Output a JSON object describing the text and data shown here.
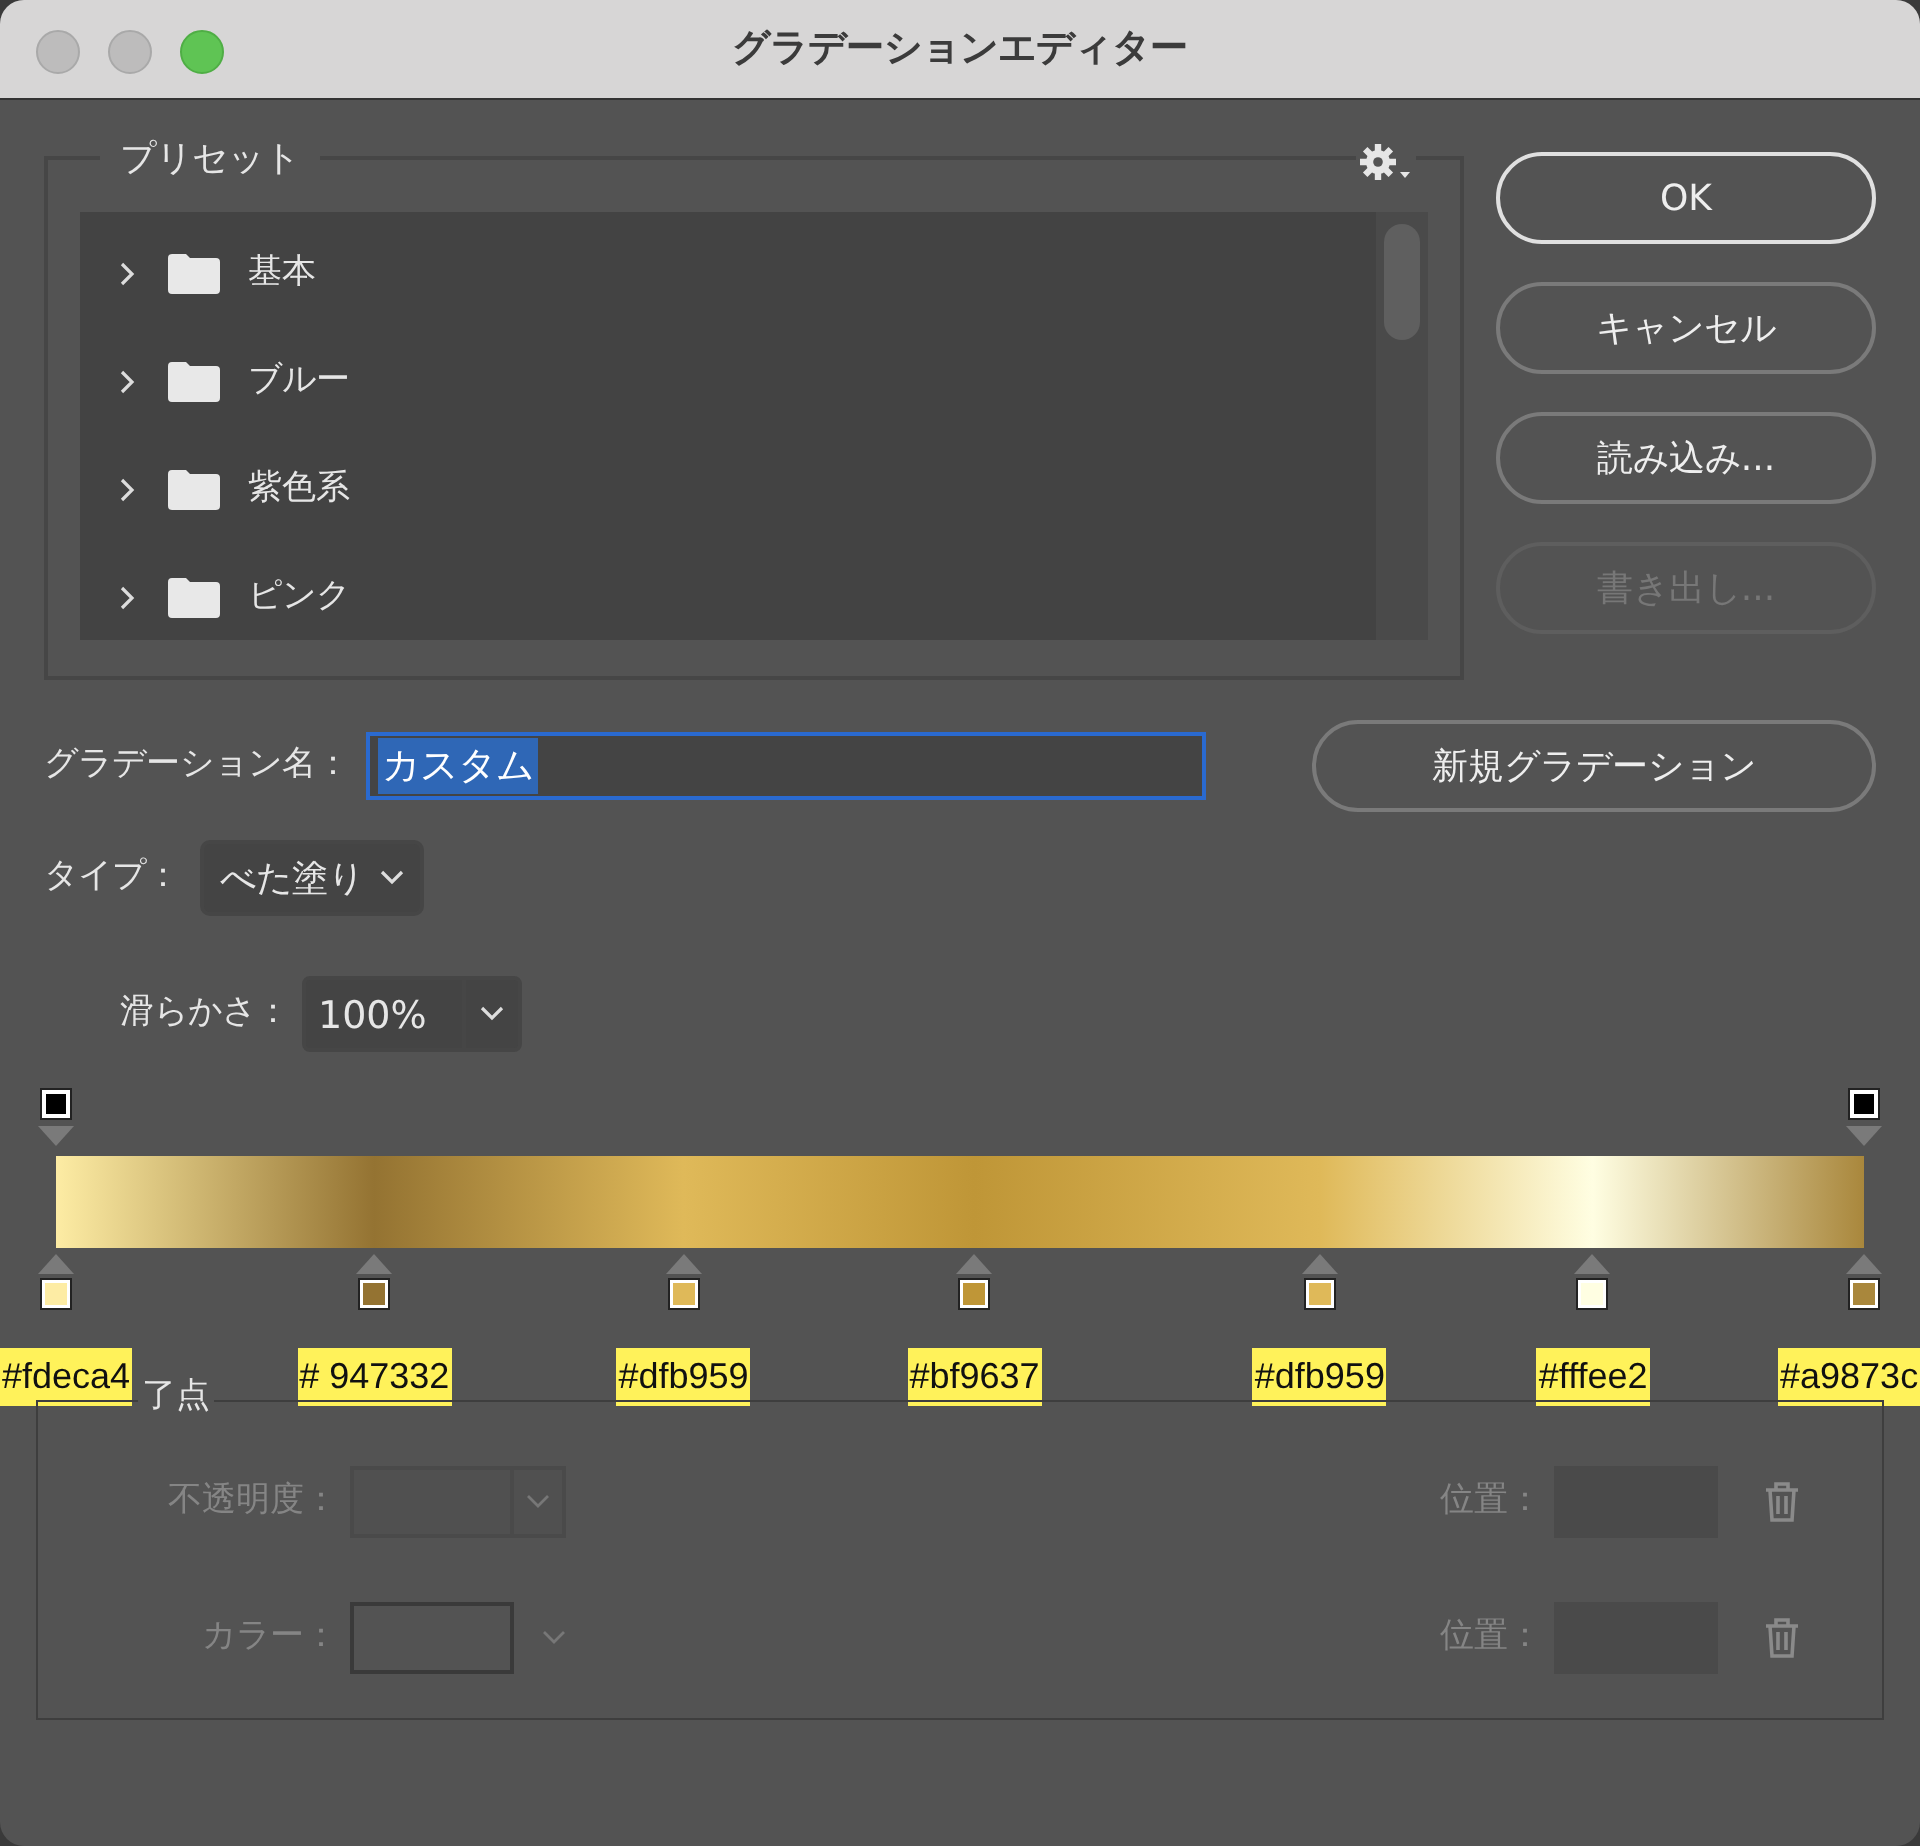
{
  "window": {
    "title": "グラデーションエディター"
  },
  "presets": {
    "legend": "プリセット",
    "items": [
      {
        "label": "基本",
        "expanded": false
      },
      {
        "label": "ブルー",
        "expanded": false
      },
      {
        "label": "紫色系",
        "expanded": false
      },
      {
        "label": "ピンク",
        "expanded": false
      }
    ]
  },
  "buttons": [
    {
      "label": "OK",
      "kind": "default",
      "disabled": false
    },
    {
      "label": "キャンセル",
      "kind": "normal",
      "disabled": false
    },
    {
      "label": "読み込み...",
      "kind": "normal",
      "disabled": false
    },
    {
      "label": "書き出し...",
      "kind": "normal",
      "disabled": true
    }
  ],
  "name_field": {
    "label": "グラデーション名：",
    "value": "カスタム"
  },
  "new_button": {
    "label": "新規グラデーション"
  },
  "type": {
    "label": "タイプ：",
    "value": "べた塗り"
  },
  "smoothness": {
    "label": "滑らかさ：",
    "value": "100%"
  },
  "opacity_stops": [
    {
      "color": "#000000",
      "level": 0
    },
    {
      "color": "#000000",
      "level": 1
    }
  ],
  "color_stops": [
    {
      "color": "#fdeca4",
      "level": 0,
      "label": "#fdeca4"
    },
    {
      "color": "#947332",
      "level": 0.176,
      "label": "# 947332"
    },
    {
      "color": "#dfb959",
      "level": 0.347,
      "label": "#dfb959"
    },
    {
      "color": "#bf9637",
      "level": 0.508,
      "label": "#bf9637"
    },
    {
      "color": "#dfb959",
      "level": 0.699,
      "label": "#dfb959"
    },
    {
      "color": "#fffee2",
      "level": 0.85,
      "label": "#fffee2"
    },
    {
      "color": "#a9873c",
      "level": 1,
      "label": "#a9873c"
    }
  ],
  "stops_group": {
    "legend": "了点",
    "opacity_label": "不透明度：",
    "opacity_position_label": "位置：",
    "color_label": "カラー：",
    "color_position_label": "位置：",
    "disabled": true
  }
}
